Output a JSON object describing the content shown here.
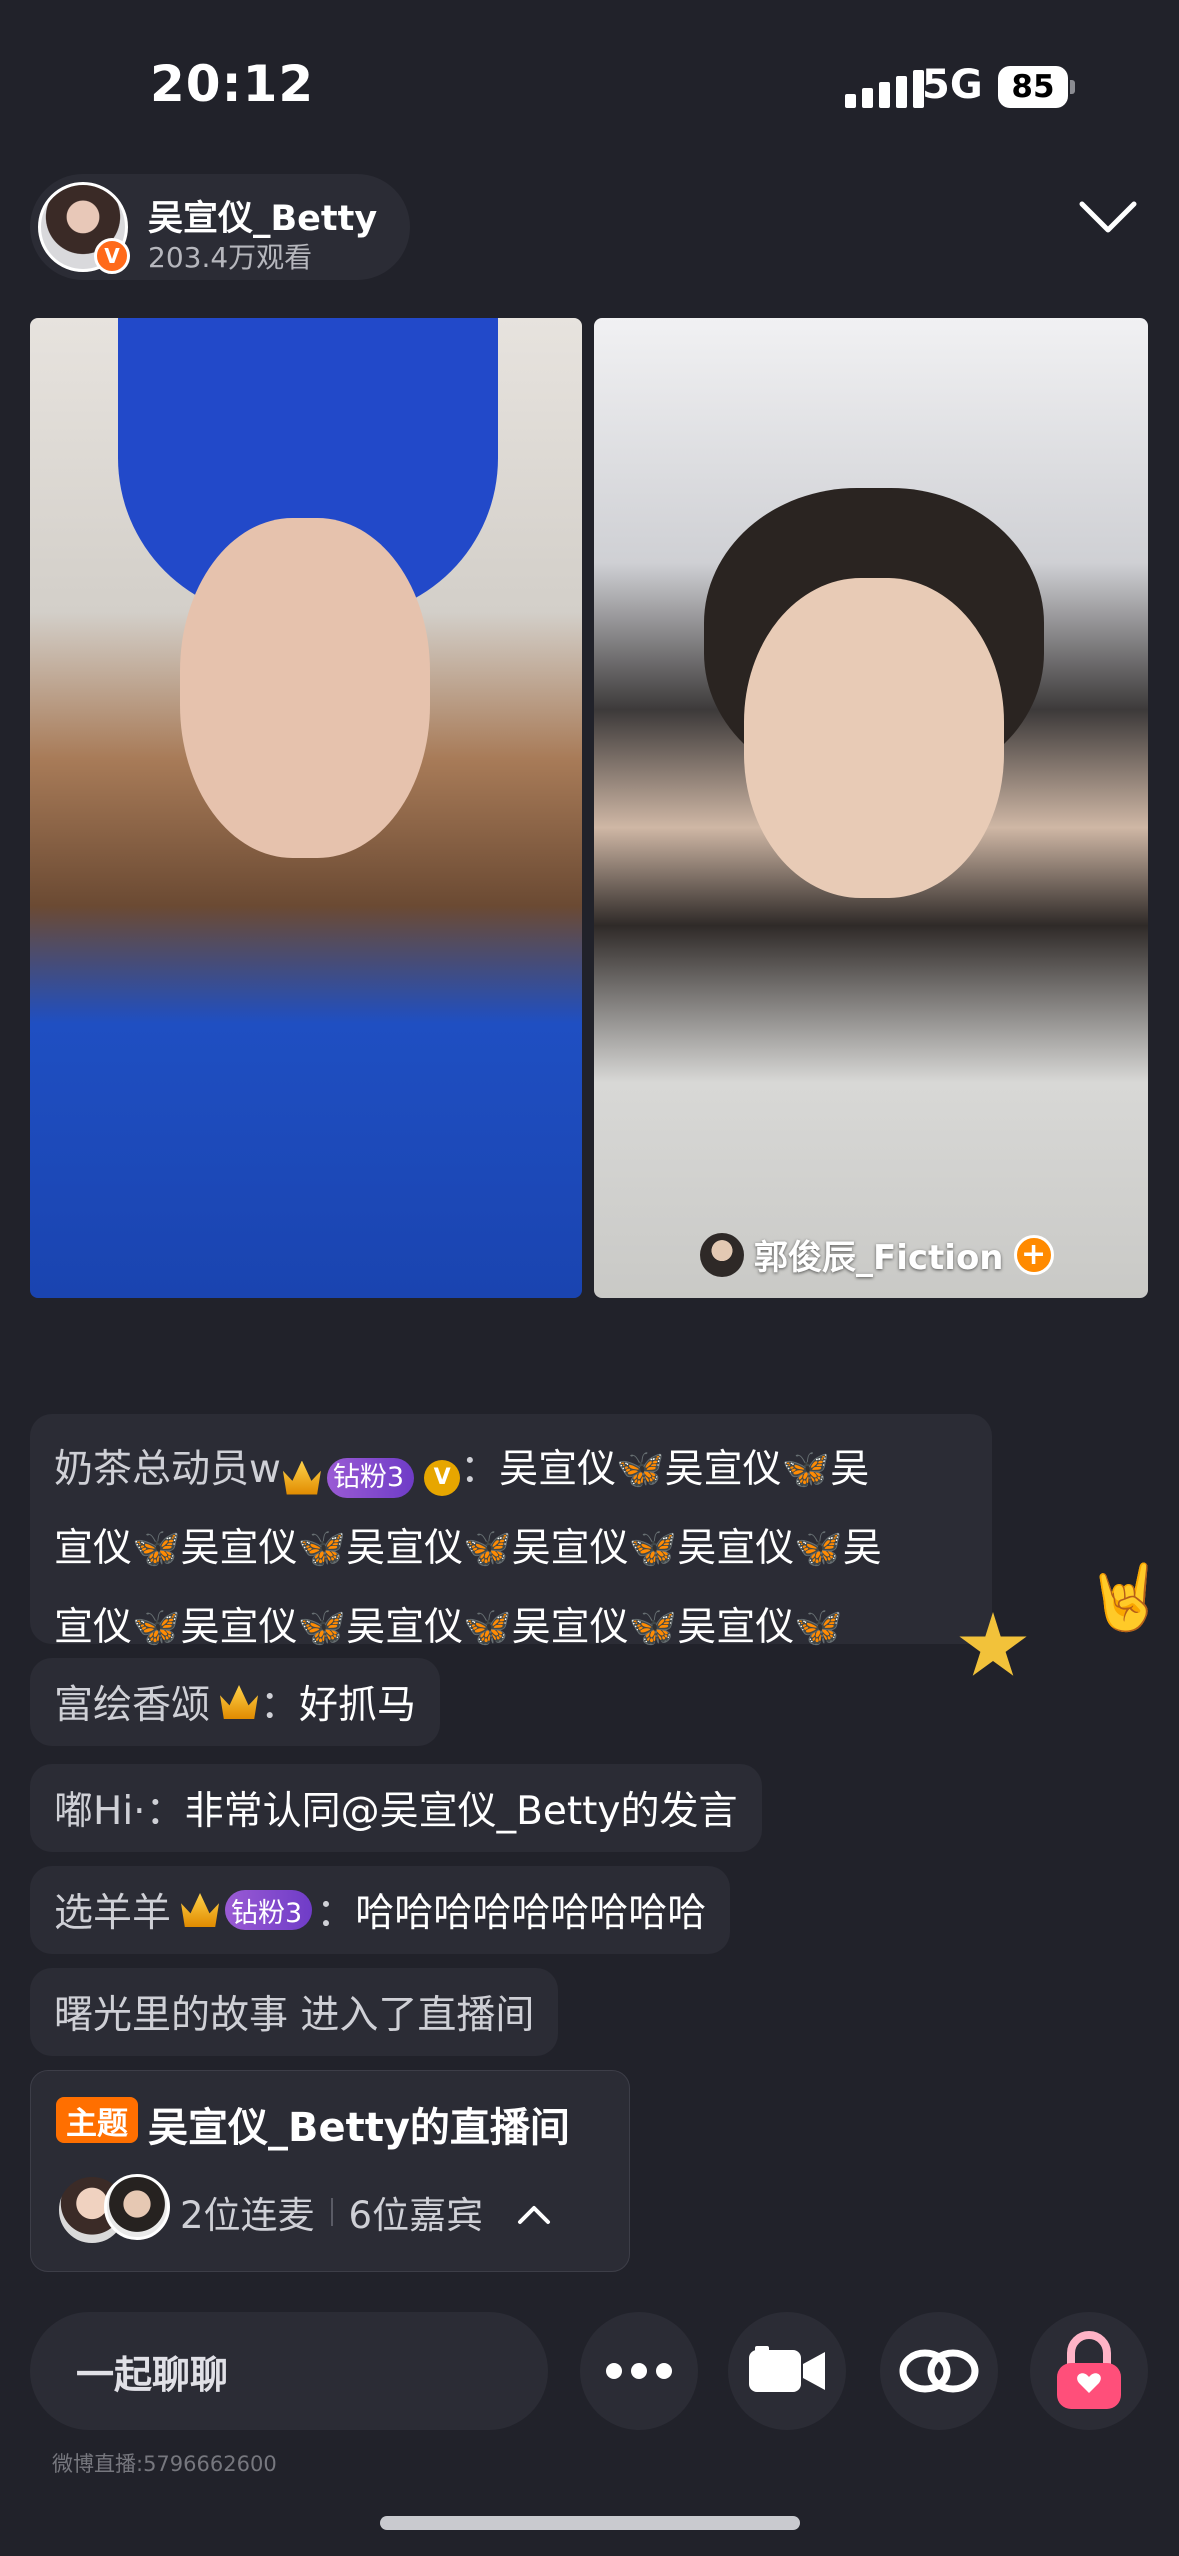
{
  "status_bar": {
    "time": "20:12",
    "network": "5G",
    "battery": "85"
  },
  "host": {
    "name": "吴宣仪_Betty",
    "views": "203.4万观看",
    "verified_mark": "V"
  },
  "guest": {
    "name": "郭俊辰_Fiction",
    "follow_symbol": "+"
  },
  "comments": [
    {
      "user": "奶茶总动员w",
      "badge": "钻粉3",
      "verified_mark": "V",
      "separator": "：",
      "lines": [
        "吴宣仪🦋吴宣仪🦋吴",
        "宣仪🦋吴宣仪🦋吴宣仪🦋吴宣仪🦋吴宣仪🦋吴",
        "宣仪🦋吴宣仪🦋吴宣仪🦋吴宣仪🦋吴宣仪🦋"
      ]
    },
    {
      "user": "富绘香颂",
      "separator": "：",
      "text": "好抓马"
    },
    {
      "user": "嘟Hi·",
      "separator": "：",
      "text": "非常认同@吴宣仪_Betty的发言"
    },
    {
      "user": "选羊羊",
      "badge": "钻粉3",
      "separator": "：",
      "text": "哈哈哈哈哈哈哈哈哈"
    },
    {
      "text": "曙光里的故事 进入了直播间"
    }
  ],
  "topic": {
    "tag": "主题",
    "title": "吴宣仪_Betty的直播间",
    "co_hosts": "2位连麦",
    "guests": "6位嘉宾"
  },
  "bottom_bar": {
    "chat_placeholder": "一起聊聊",
    "room_id": "微博直播:5796662600"
  },
  "colors": {
    "accent": "#ff6f00",
    "badge_purple": "#8a4fd0",
    "background": "#21222a"
  }
}
